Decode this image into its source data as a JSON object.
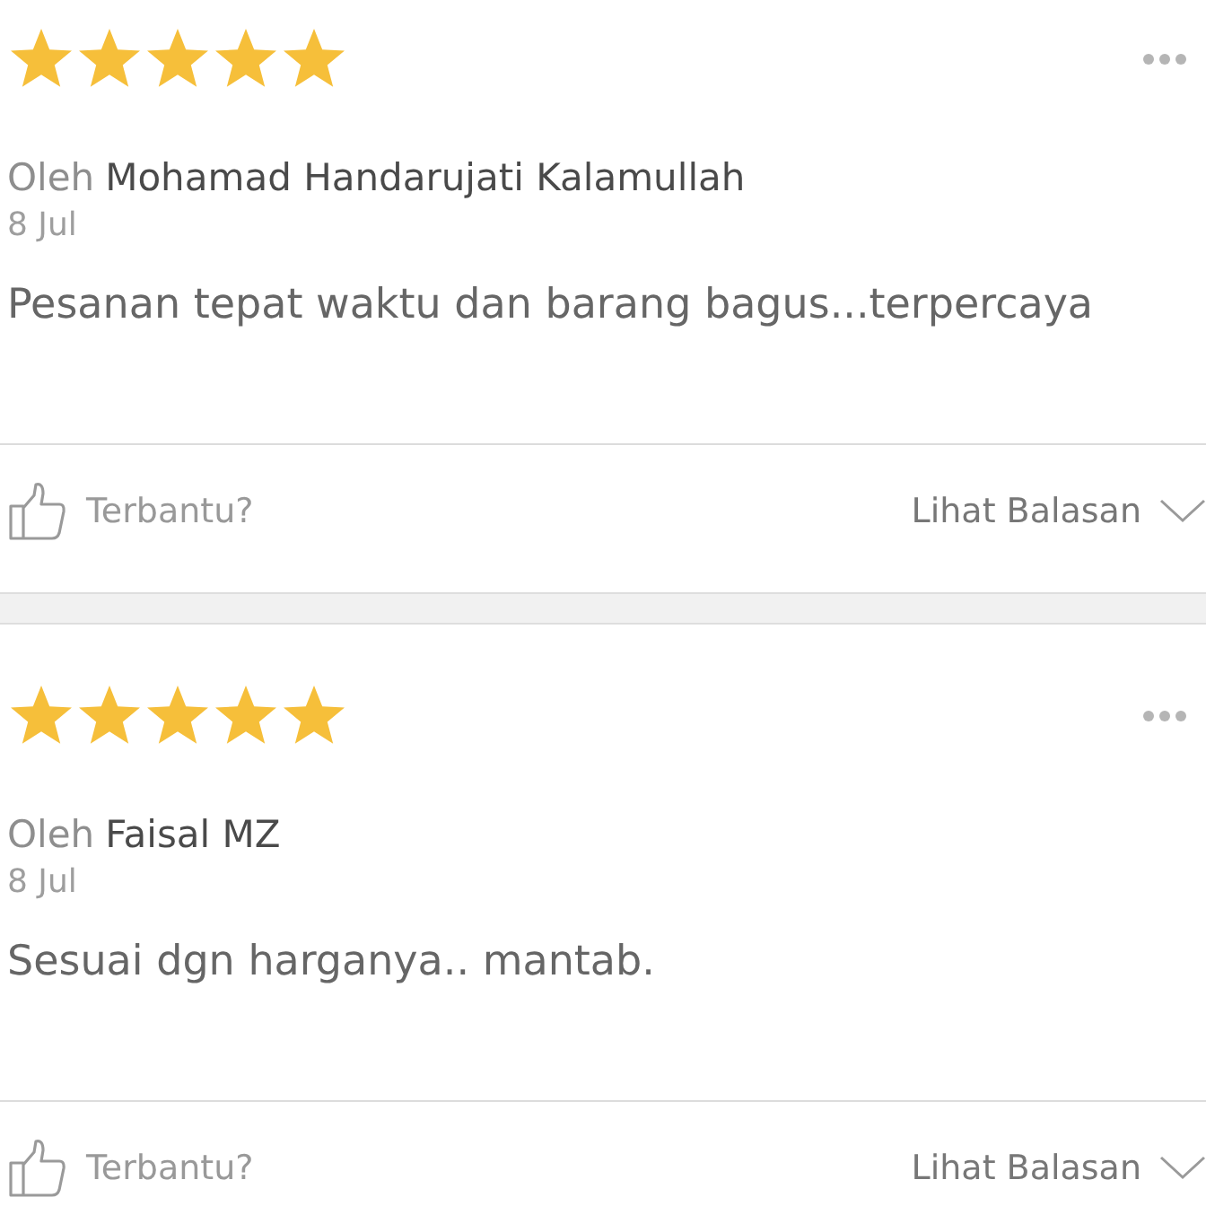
{
  "reviews": [
    {
      "stars": 5,
      "by_label": "Oleh",
      "author": "Mohamad Handarujati Kalamullah",
      "date": "8 Jul",
      "text": "Pesanan tepat waktu dan barang bagus...terpercaya",
      "helpful_label": "Terbantu?",
      "replies_label": "Lihat Balasan"
    },
    {
      "stars": 5,
      "by_label": "Oleh",
      "author": "Faisal MZ",
      "date": "8 Jul",
      "text": "Sesuai dgn harganya.. mantab.",
      "helpful_label": "Terbantu?",
      "replies_label": "Lihat Balasan"
    }
  ]
}
